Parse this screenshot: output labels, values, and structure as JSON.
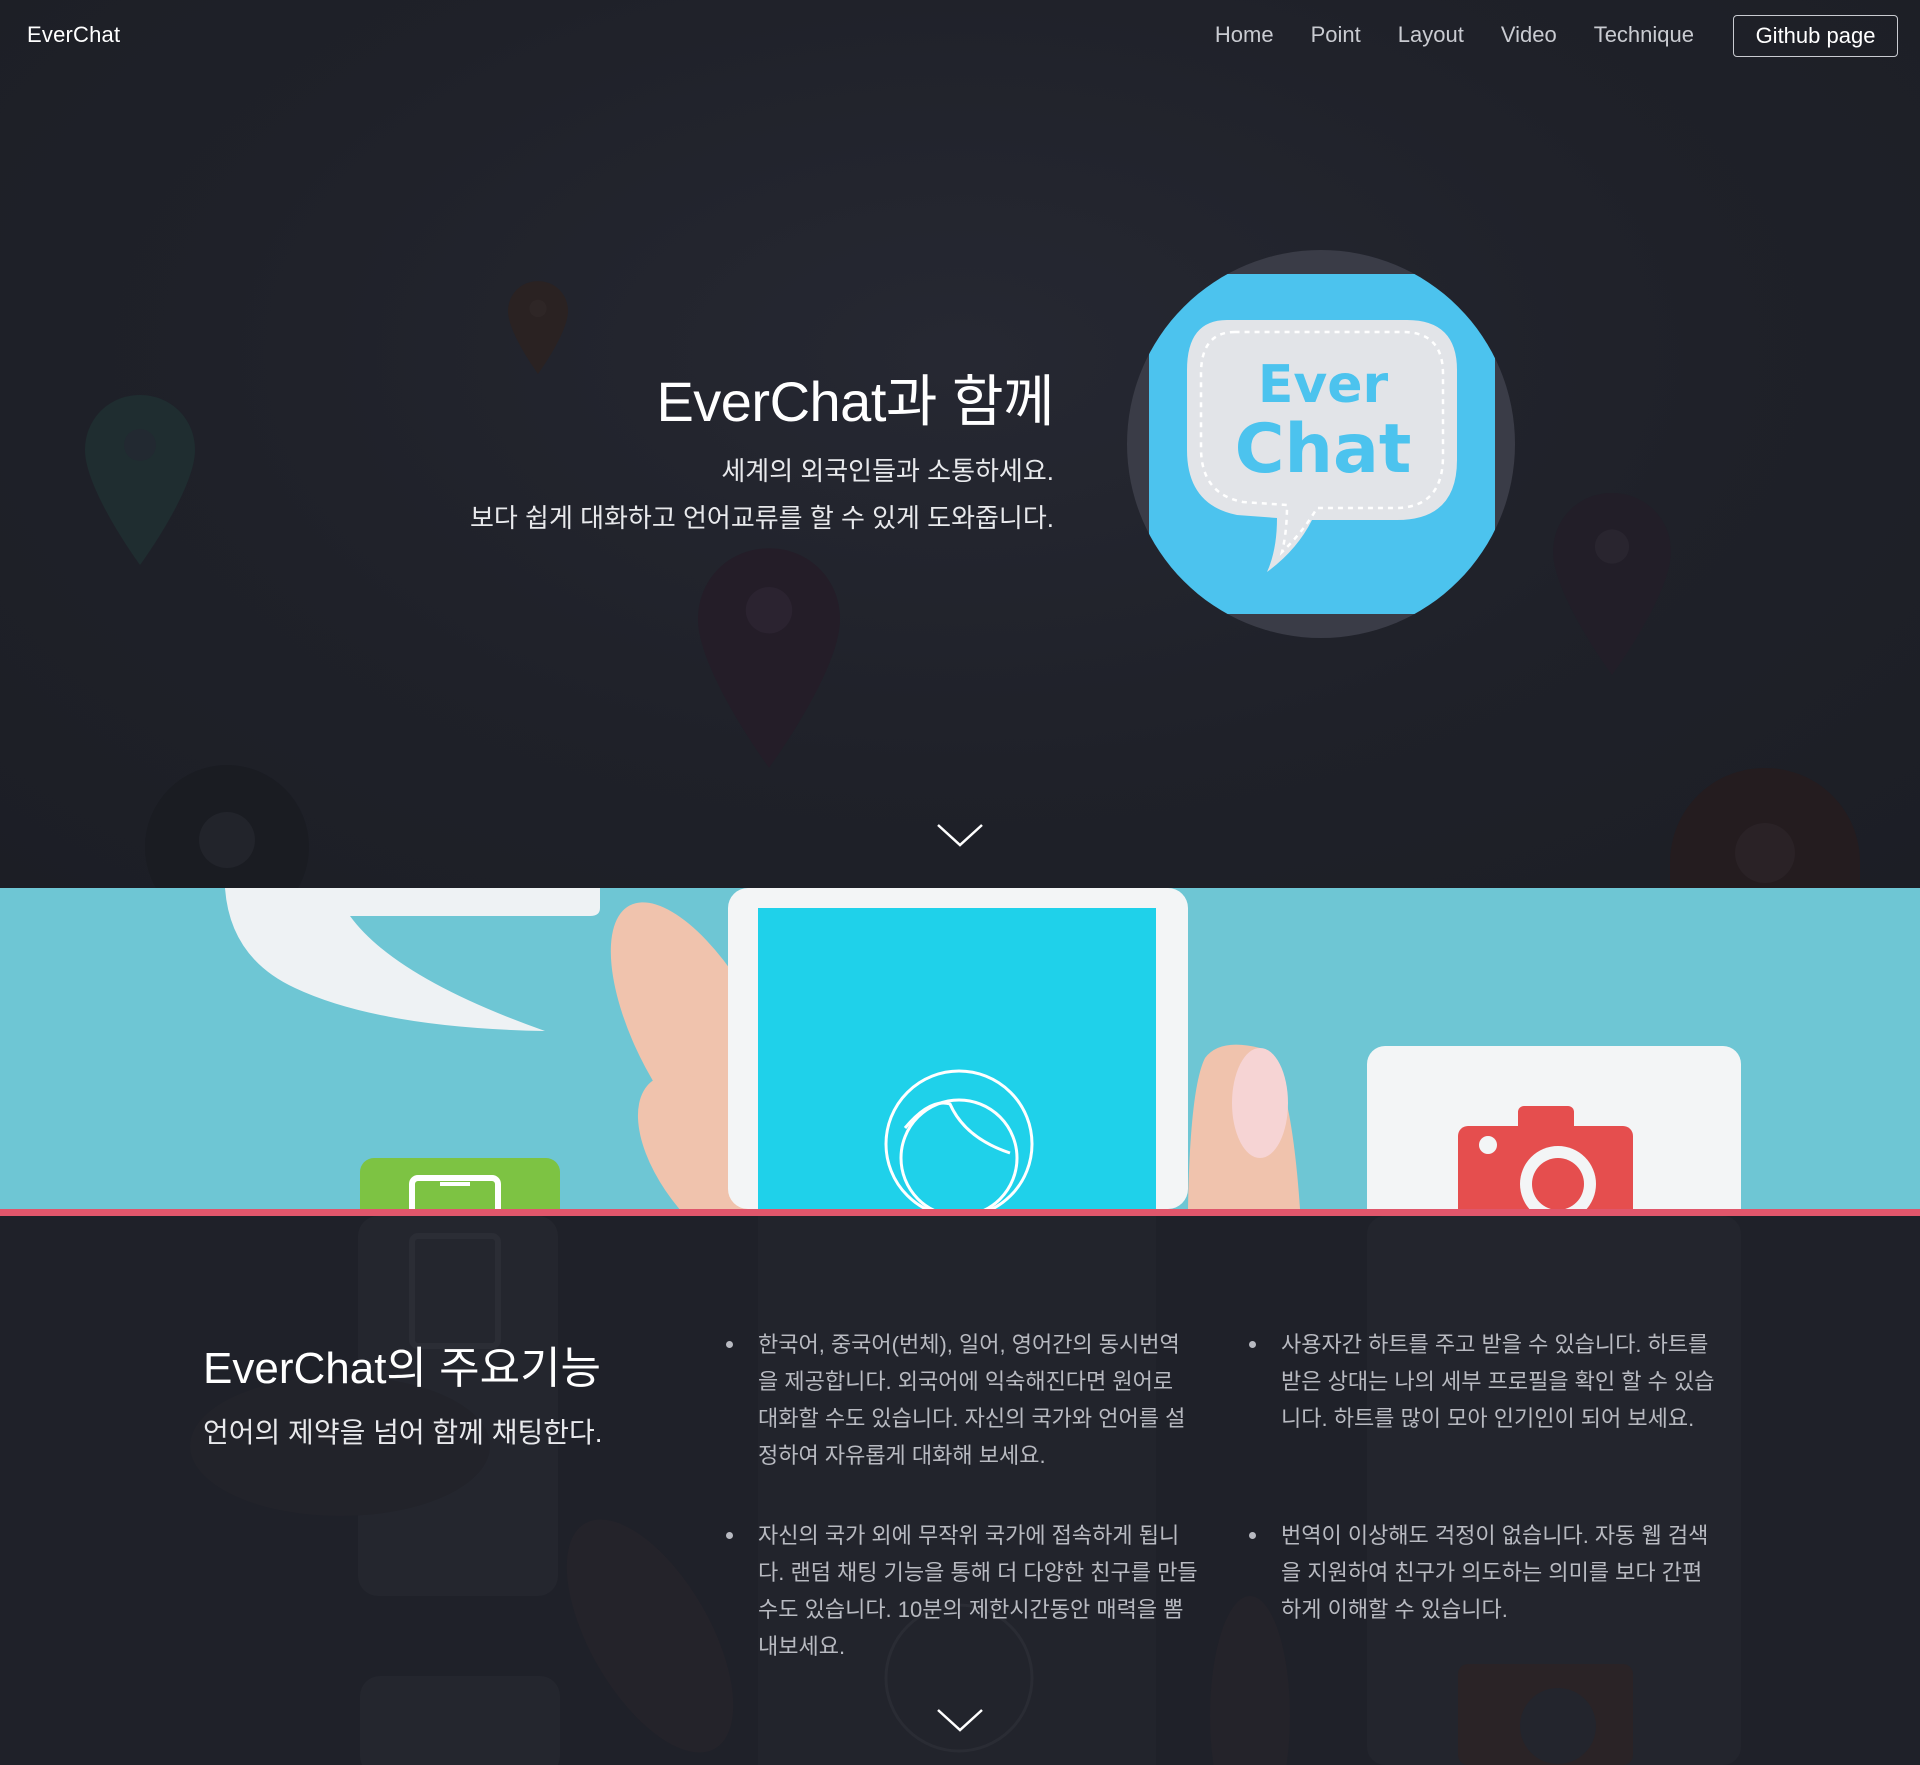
{
  "nav": {
    "brand": "EverChat",
    "links": [
      "Home",
      "Point",
      "Layout",
      "Video",
      "Technique"
    ],
    "github": "Github page"
  },
  "hero": {
    "title": "EverChat과 함께",
    "line1": "세계의 외국인들과 소통하세요.",
    "line2": "보다 쉽게 대화하고 언어교류를 할 수 있게 도와줍니다.",
    "logo_text_1": "Ever",
    "logo_text_2": "Chat"
  },
  "features": {
    "title": "EverChat의 주요기능",
    "subtitle": "언어의 제약을 넘어 함께 채팅한다.",
    "items": [
      "한국어, 중국어(번체), 일어, 영어간의 동시번역을 제공합니다. 외국어에 익숙해진다면 원어로 대화할 수도 있습니다. 자신의 국가와 언어를 설정하여 자유롭게 대화해 보세요.",
      "사용자간 하트를 주고 받을 수 있습니다. 하트를 받은 상대는 나의 세부 프로필을 확인 할 수 있습니다. 하트를 많이 모아 인기인이 되어 보세요.",
      "자신의 국가 외에 무작위 국가에 접속하게 됩니다. 랜덤 채팅 기능을 통해 더 다양한 친구를 만들수도 있습니다. 10분의 제한시간동안 매력을 뽐내보세요.",
      "번역이 이상해도 걱정이 없습니다. 자동 웹 검색을 지원하여 친구가 의도하는 의미를 보다 간편하게 이해할 수 있습니다."
    ]
  },
  "colors": {
    "background": "#1f2129",
    "band": "#6ec6d4",
    "accent_line": "#e0566b",
    "logo_blue": "#4cc3ee"
  },
  "icons": [
    "chevron-down-icon",
    "map-pin-icon",
    "speech-bubble-icon",
    "camera-icon",
    "phone-icon",
    "face-icon"
  ]
}
